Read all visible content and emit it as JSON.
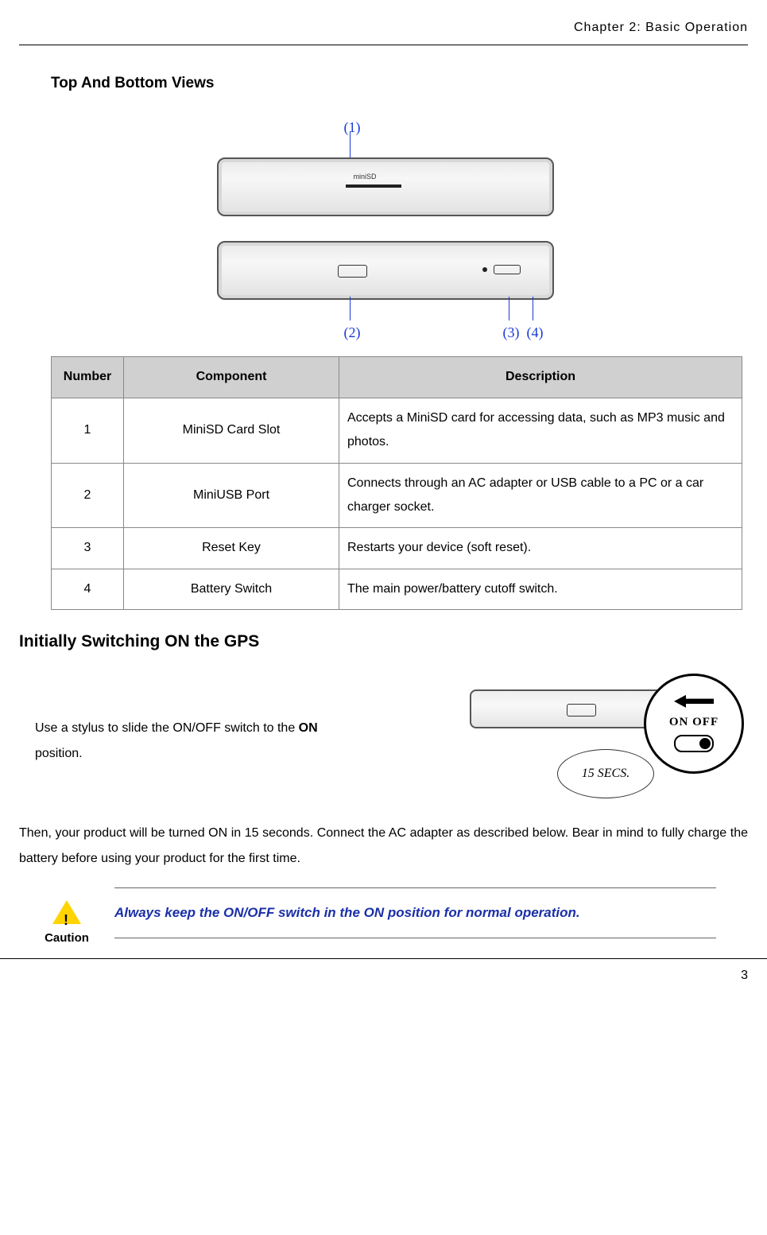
{
  "header": {
    "running": "Chapter 2: Basic Operation"
  },
  "sectionA": {
    "title": "Top And Bottom Views"
  },
  "callouts": {
    "c1": "(1)",
    "c2": "(2)",
    "c3": "(3)",
    "c4": "(4)",
    "miniSD": "miniSD"
  },
  "table": {
    "head": {
      "num": "Number",
      "comp": "Component",
      "desc": "Description"
    },
    "rows": [
      {
        "num": "1",
        "comp": "MiniSD Card Slot",
        "desc": "Accepts a MiniSD card for accessing data, such as MP3 music and photos."
      },
      {
        "num": "2",
        "comp": "MiniUSB Port",
        "desc": "Connects through an AC adapter or USB cable to a PC or a car charger socket."
      },
      {
        "num": "3",
        "comp": "Reset Key",
        "desc": "Restarts your device (soft reset)."
      },
      {
        "num": "4",
        "comp": "Battery Switch",
        "desc": "The main power/battery cutoff switch."
      }
    ]
  },
  "sectionB": {
    "title": "Initially Switching ON the GPS",
    "instr_pre": "Use a stylus to slide the ON/OFF switch to the ",
    "instr_bold": "ON",
    "instr_post": " position."
  },
  "zoom": {
    "on_off": "ON OFF",
    "secs": "15 SECS."
  },
  "para": "Then, your product will be turned ON in 15 seconds. Connect the AC adapter as described below. Bear in mind to fully charge the battery before using your product for the first time.",
  "caution": {
    "label": "Caution",
    "text": "Always keep the ON/OFF switch in the ON position for normal operation."
  },
  "footer": {
    "page": "3"
  }
}
